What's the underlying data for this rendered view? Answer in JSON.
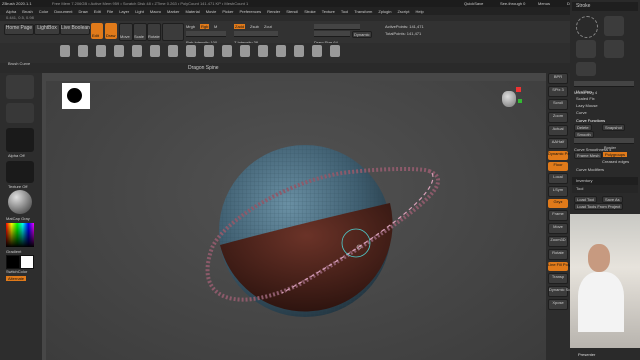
{
  "titlebar": {
    "app_title": "ZBrush 2020.1.1",
    "mem_info": "Free Mem 7.206GB • Active Mem 959 • Scratch Disk 48 • ZTime 0.263 • PolyCount 141.471 KP • MeshCount 1",
    "quicksave": "QuickSave",
    "see_through": "See-through 0",
    "menus_label": "Menus",
    "default_zscript": "DefaultZScript"
  },
  "menubar": {
    "items": [
      "Alpha",
      "Brush",
      "Color",
      "Document",
      "Draw",
      "Edit",
      "File",
      "Layer",
      "Light",
      "Macro",
      "Marker",
      "Material",
      "Movie",
      "Picker",
      "Preferences",
      "Render",
      "Stencil",
      "Stroke",
      "Texture",
      "Tool",
      "Transform",
      "Zplugin",
      "Zscript",
      "Help"
    ]
  },
  "infobar": {
    "coords": "0.441, 0.5, 0.98"
  },
  "toolbar": {
    "home_page": "Home Page",
    "lightbox": "LightBox",
    "live_boolean": "Live Boolean",
    "edit": "Edit",
    "draw": "Draw",
    "move": "Move",
    "scale": "Scale",
    "rotate": "Rotate",
    "mrgb": "Mrgb",
    "rgb": "Rgb",
    "m": "M",
    "zadd": "Zadd",
    "zsub": "Zsub",
    "zcut": "Zcut",
    "rgb_intensity": "Rgb Intensity 100",
    "z_intensity": "Z Intensity 38",
    "focal_shift": "Focal Shift 0",
    "draw_size": "Draw Size 64",
    "dynamic": "Dynamic",
    "active_points": "ActivePoints: 141,471",
    "total_points": "TotalPoints: 141,471"
  },
  "shelf": {
    "brushes": [
      "Standard",
      "ClayBuildup",
      "DamStandard",
      "Move",
      "hPolish",
      "TrimDynamic",
      "Inflat",
      "Pinch",
      "SnakeHook",
      "IMM Primitives",
      "CurveTube",
      "ZModeler",
      "SelectRect",
      "SliceCurve",
      "ClipCurve",
      "Dragon Spine"
    ],
    "active_label": "Dragon Spine"
  },
  "leftshelf": {
    "brush_label": "Brush Curve",
    "alpha_label": "Alpha Off",
    "texture_label": "Texture Off",
    "material_label": "MatCap Gray",
    "gradient_label": "Gradient",
    "switch_label": "SwitchColor",
    "alternate_label": "Alternate",
    "colors": {
      "main": "#000000",
      "secondary": "#ffffff"
    }
  },
  "rightshelf": {
    "items": [
      "BPR",
      "SPix 3",
      "Scroll",
      "Zoom",
      "Actual",
      "AAHalf",
      "Dynamic Persp",
      "Floor",
      "Local",
      "LSym",
      "Gxyz",
      "Frame",
      "Move",
      "Zoom3D",
      "Rotate",
      "Line Fill PolyF",
      "Transp",
      "Dynamic Solo",
      "Xpose"
    ]
  },
  "tray": {
    "stroke_title": "Stroke",
    "mouse_avg": "Mouse Avg 4",
    "modifiers": "Modifiers",
    "scaled_fix": "Scaled Fix",
    "lazy_mouse": "Lazy Mouse",
    "curve": "Curve",
    "curve_functions": "Curve Functions",
    "delete": "Delete",
    "snapshot": "Snapshot",
    "smooth": "Smooth",
    "curve_smoothness": "Curve Smoothness 4",
    "border": "Border",
    "frame_mesh": "Frame Mesh",
    "polygroups": "Polygroups",
    "creased_edges": "Creased edges",
    "curve_modifiers": "Curve Modifiers",
    "inventory": "Inventory",
    "tool": "Tool",
    "load_tool": "Load Tool",
    "save_as": "Save As",
    "load_tools_from_project": "Load Tools From Project",
    "presenter_label": "Presenter"
  },
  "viewport": {
    "sphere_top_color": "#4a6d80",
    "sphere_bottom_color": "#5a2a22",
    "curve_color": "#c8a0b0"
  }
}
